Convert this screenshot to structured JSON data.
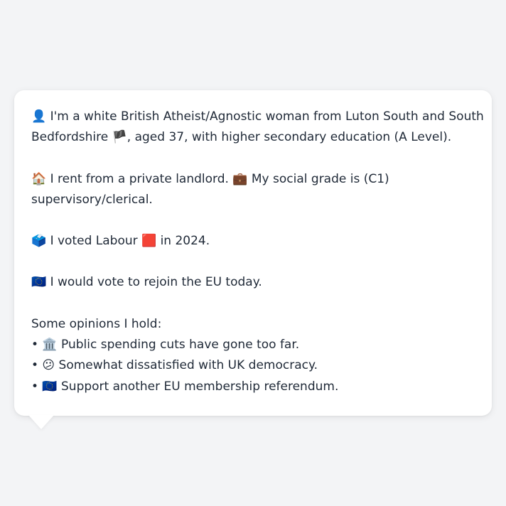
{
  "profile": {
    "intro_line1": "👤 I'm a white British Atheist/Agnostic woman from Luton South and South",
    "intro_line2": "Bedfordshire 🏴, aged 37, with higher secondary education (A Level).",
    "housing_line1": "🏠 I rent from a private landlord. 💼 My social grade is (C1)",
    "housing_line2": "supervisory/clerical.",
    "vote_2024": "🗳️ I voted Labour 🟥 in 2024.",
    "eu_stance": "🇪🇺 I would vote to rejoin the EU today."
  },
  "opinions": {
    "heading": "Some opinions I hold:",
    "items": [
      "• 🏛️ Public spending cuts have gone too far.",
      "• 😕 Somewhat dissatisfied with UK democracy.",
      "• 🇪🇺 Support another EU membership referendum."
    ]
  }
}
